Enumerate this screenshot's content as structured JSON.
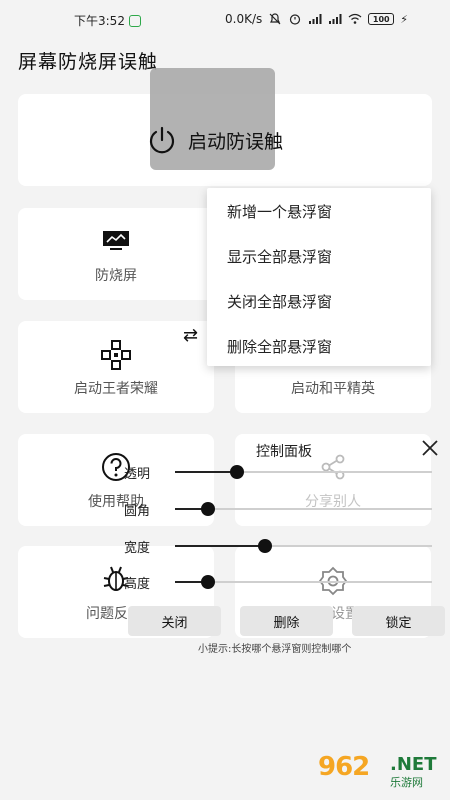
{
  "status_bar": {
    "time": "下午3:52",
    "net_speed": "0.0K/s",
    "battery": "100"
  },
  "app": {
    "title": "屏幕防烧屏误触"
  },
  "start_card": {
    "label": "启动防误触"
  },
  "cards": {
    "anti_burn": "防烧屏",
    "wzry": "启动王者荣耀",
    "hpjy": "启动和平精英",
    "help": "使用帮助",
    "share": "分享别人",
    "feedback": "问题反",
    "settings": "设置"
  },
  "menu": {
    "items": [
      "新增一个悬浮窗",
      "显示全部悬浮窗",
      "关闭全部悬浮窗",
      "删除全部悬浮窗"
    ]
  },
  "control_panel": {
    "title": "控制面板",
    "sliders": [
      {
        "label": "透明",
        "value": 0.24
      },
      {
        "label": "圆角",
        "value": 0.13
      },
      {
        "label": "宽度",
        "value": 0.35
      },
      {
        "label": "高度",
        "value": 0.13
      }
    ],
    "buttons": {
      "close": "关闭",
      "delete": "删除",
      "lock": "锁定"
    },
    "hint": "小提示:长按哪个悬浮窗则控制哪个"
  },
  "watermark": {
    "number": "962",
    "net": ".NET",
    "cn": "乐游网"
  }
}
